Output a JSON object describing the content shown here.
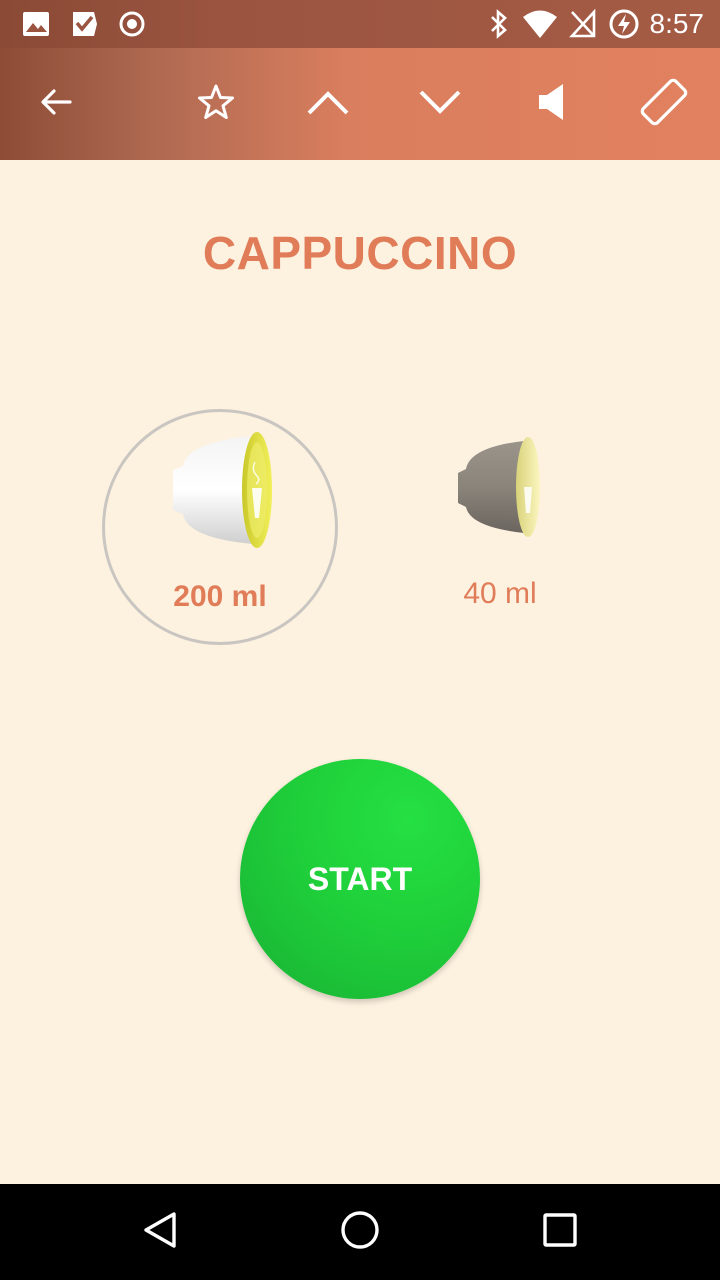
{
  "status_bar": {
    "time": "8:57",
    "left_icons": [
      "image-icon",
      "check-icon",
      "record-icon"
    ],
    "right_icons": [
      "bluetooth-icon",
      "wifi-icon",
      "no-sim-icon",
      "battery-charging-icon"
    ]
  },
  "toolbar": {
    "icons": [
      "back-arrow-icon",
      "star-icon",
      "chevron-up-icon",
      "chevron-down-icon",
      "volume-icon",
      "rotate-screen-icon"
    ]
  },
  "drink": {
    "title": "CAPPUCCINO"
  },
  "capsules": [
    {
      "volume": "200 ml",
      "selected": true,
      "shell_color": "#e2e2e2",
      "lid_color": "#e2e23a"
    },
    {
      "volume": "40 ml",
      "selected": false,
      "shell_color": "#847e76",
      "lid_color": "#f3eca0"
    }
  ],
  "start_button": {
    "label": "START",
    "color": "#1fcf3a"
  },
  "nav_bar": {
    "icons": [
      "back-triangle-icon",
      "home-circle-icon",
      "recents-square-icon"
    ]
  }
}
